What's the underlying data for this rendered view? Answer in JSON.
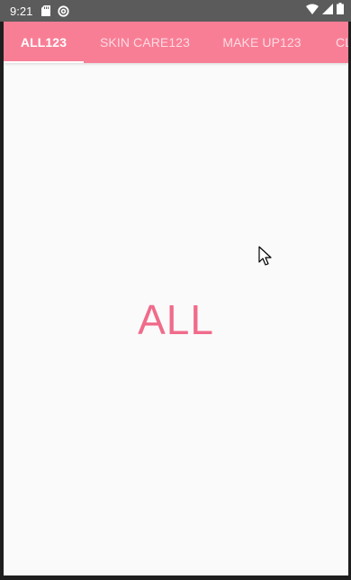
{
  "status_bar": {
    "time": "9:21",
    "icons_left": [
      "sd-card-icon",
      "sync-icon"
    ],
    "icons_right": [
      "wifi-icon",
      "signal-icon",
      "battery-icon"
    ]
  },
  "tabs": [
    {
      "label": "ALL123",
      "active": true
    },
    {
      "label": "SKIN CARE123",
      "active": false
    },
    {
      "label": "MAKE UP123",
      "active": false
    },
    {
      "label": "CL",
      "active": false
    }
  ],
  "content": {
    "page_label": "ALL"
  },
  "colors": {
    "accent": "#f87e96",
    "label_color": "#f06b8a",
    "background": "#fafafa",
    "status_bar": "#5b5b5b"
  }
}
